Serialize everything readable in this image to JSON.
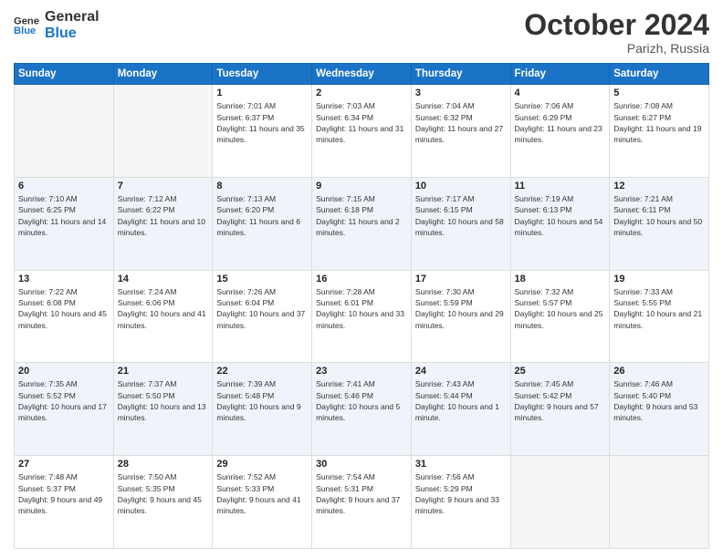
{
  "header": {
    "logo_line1": "General",
    "logo_line2": "Blue",
    "month": "October 2024",
    "location": "Parizh, Russia"
  },
  "days_of_week": [
    "Sunday",
    "Monday",
    "Tuesday",
    "Wednesday",
    "Thursday",
    "Friday",
    "Saturday"
  ],
  "weeks": [
    [
      {
        "day": "",
        "sunrise": "",
        "sunset": "",
        "daylight": ""
      },
      {
        "day": "",
        "sunrise": "",
        "sunset": "",
        "daylight": ""
      },
      {
        "day": "1",
        "sunrise": "Sunrise: 7:01 AM",
        "sunset": "Sunset: 6:37 PM",
        "daylight": "Daylight: 11 hours and 35 minutes."
      },
      {
        "day": "2",
        "sunrise": "Sunrise: 7:03 AM",
        "sunset": "Sunset: 6:34 PM",
        "daylight": "Daylight: 11 hours and 31 minutes."
      },
      {
        "day": "3",
        "sunrise": "Sunrise: 7:04 AM",
        "sunset": "Sunset: 6:32 PM",
        "daylight": "Daylight: 11 hours and 27 minutes."
      },
      {
        "day": "4",
        "sunrise": "Sunrise: 7:06 AM",
        "sunset": "Sunset: 6:29 PM",
        "daylight": "Daylight: 11 hours and 23 minutes."
      },
      {
        "day": "5",
        "sunrise": "Sunrise: 7:08 AM",
        "sunset": "Sunset: 6:27 PM",
        "daylight": "Daylight: 11 hours and 19 minutes."
      }
    ],
    [
      {
        "day": "6",
        "sunrise": "Sunrise: 7:10 AM",
        "sunset": "Sunset: 6:25 PM",
        "daylight": "Daylight: 11 hours and 14 minutes."
      },
      {
        "day": "7",
        "sunrise": "Sunrise: 7:12 AM",
        "sunset": "Sunset: 6:22 PM",
        "daylight": "Daylight: 11 hours and 10 minutes."
      },
      {
        "day": "8",
        "sunrise": "Sunrise: 7:13 AM",
        "sunset": "Sunset: 6:20 PM",
        "daylight": "Daylight: 11 hours and 6 minutes."
      },
      {
        "day": "9",
        "sunrise": "Sunrise: 7:15 AM",
        "sunset": "Sunset: 6:18 PM",
        "daylight": "Daylight: 11 hours and 2 minutes."
      },
      {
        "day": "10",
        "sunrise": "Sunrise: 7:17 AM",
        "sunset": "Sunset: 6:15 PM",
        "daylight": "Daylight: 10 hours and 58 minutes."
      },
      {
        "day": "11",
        "sunrise": "Sunrise: 7:19 AM",
        "sunset": "Sunset: 6:13 PM",
        "daylight": "Daylight: 10 hours and 54 minutes."
      },
      {
        "day": "12",
        "sunrise": "Sunrise: 7:21 AM",
        "sunset": "Sunset: 6:11 PM",
        "daylight": "Daylight: 10 hours and 50 minutes."
      }
    ],
    [
      {
        "day": "13",
        "sunrise": "Sunrise: 7:22 AM",
        "sunset": "Sunset: 6:08 PM",
        "daylight": "Daylight: 10 hours and 45 minutes."
      },
      {
        "day": "14",
        "sunrise": "Sunrise: 7:24 AM",
        "sunset": "Sunset: 6:06 PM",
        "daylight": "Daylight: 10 hours and 41 minutes."
      },
      {
        "day": "15",
        "sunrise": "Sunrise: 7:26 AM",
        "sunset": "Sunset: 6:04 PM",
        "daylight": "Daylight: 10 hours and 37 minutes."
      },
      {
        "day": "16",
        "sunrise": "Sunrise: 7:28 AM",
        "sunset": "Sunset: 6:01 PM",
        "daylight": "Daylight: 10 hours and 33 minutes."
      },
      {
        "day": "17",
        "sunrise": "Sunrise: 7:30 AM",
        "sunset": "Sunset: 5:59 PM",
        "daylight": "Daylight: 10 hours and 29 minutes."
      },
      {
        "day": "18",
        "sunrise": "Sunrise: 7:32 AM",
        "sunset": "Sunset: 5:57 PM",
        "daylight": "Daylight: 10 hours and 25 minutes."
      },
      {
        "day": "19",
        "sunrise": "Sunrise: 7:33 AM",
        "sunset": "Sunset: 5:55 PM",
        "daylight": "Daylight: 10 hours and 21 minutes."
      }
    ],
    [
      {
        "day": "20",
        "sunrise": "Sunrise: 7:35 AM",
        "sunset": "Sunset: 5:52 PM",
        "daylight": "Daylight: 10 hours and 17 minutes."
      },
      {
        "day": "21",
        "sunrise": "Sunrise: 7:37 AM",
        "sunset": "Sunset: 5:50 PM",
        "daylight": "Daylight: 10 hours and 13 minutes."
      },
      {
        "day": "22",
        "sunrise": "Sunrise: 7:39 AM",
        "sunset": "Sunset: 5:48 PM",
        "daylight": "Daylight: 10 hours and 9 minutes."
      },
      {
        "day": "23",
        "sunrise": "Sunrise: 7:41 AM",
        "sunset": "Sunset: 5:46 PM",
        "daylight": "Daylight: 10 hours and 5 minutes."
      },
      {
        "day": "24",
        "sunrise": "Sunrise: 7:43 AM",
        "sunset": "Sunset: 5:44 PM",
        "daylight": "Daylight: 10 hours and 1 minute."
      },
      {
        "day": "25",
        "sunrise": "Sunrise: 7:45 AM",
        "sunset": "Sunset: 5:42 PM",
        "daylight": "Daylight: 9 hours and 57 minutes."
      },
      {
        "day": "26",
        "sunrise": "Sunrise: 7:46 AM",
        "sunset": "Sunset: 5:40 PM",
        "daylight": "Daylight: 9 hours and 53 minutes."
      }
    ],
    [
      {
        "day": "27",
        "sunrise": "Sunrise: 7:48 AM",
        "sunset": "Sunset: 5:37 PM",
        "daylight": "Daylight: 9 hours and 49 minutes."
      },
      {
        "day": "28",
        "sunrise": "Sunrise: 7:50 AM",
        "sunset": "Sunset: 5:35 PM",
        "daylight": "Daylight: 9 hours and 45 minutes."
      },
      {
        "day": "29",
        "sunrise": "Sunrise: 7:52 AM",
        "sunset": "Sunset: 5:33 PM",
        "daylight": "Daylight: 9 hours and 41 minutes."
      },
      {
        "day": "30",
        "sunrise": "Sunrise: 7:54 AM",
        "sunset": "Sunset: 5:31 PM",
        "daylight": "Daylight: 9 hours and 37 minutes."
      },
      {
        "day": "31",
        "sunrise": "Sunrise: 7:56 AM",
        "sunset": "Sunset: 5:29 PM",
        "daylight": "Daylight: 9 hours and 33 minutes."
      },
      {
        "day": "",
        "sunrise": "",
        "sunset": "",
        "daylight": ""
      },
      {
        "day": "",
        "sunrise": "",
        "sunset": "",
        "daylight": ""
      }
    ]
  ]
}
